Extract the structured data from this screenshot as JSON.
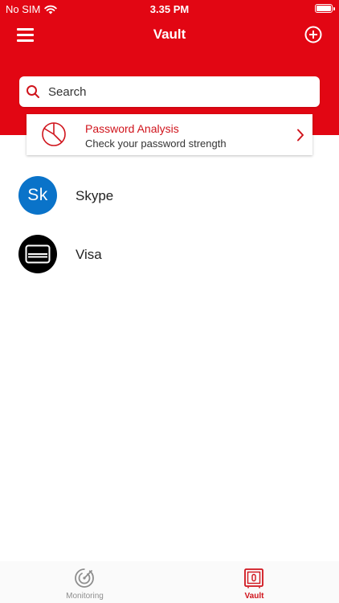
{
  "status_bar": {
    "carrier": "No SIM",
    "time": "3.35 PM"
  },
  "nav": {
    "title": "Vault"
  },
  "search": {
    "placeholder": "Search"
  },
  "password_analysis": {
    "title": "Password Analysis",
    "subtitle": "Check your password strength"
  },
  "vault_items": [
    {
      "avatar_text": "Sk",
      "name": "Skype"
    },
    {
      "avatar_icon": "credit-card-icon",
      "name": "Visa"
    }
  ],
  "tabs": [
    {
      "label": "Monitoring",
      "icon": "radar-icon",
      "active": false
    },
    {
      "label": "Vault",
      "icon": "safe-icon",
      "active": true
    }
  ],
  "colors": {
    "brand_red": "#e20613",
    "accent_red": "#d0141c",
    "skype_blue": "#0a73c9",
    "inactive_gray": "#8e8e8e"
  }
}
